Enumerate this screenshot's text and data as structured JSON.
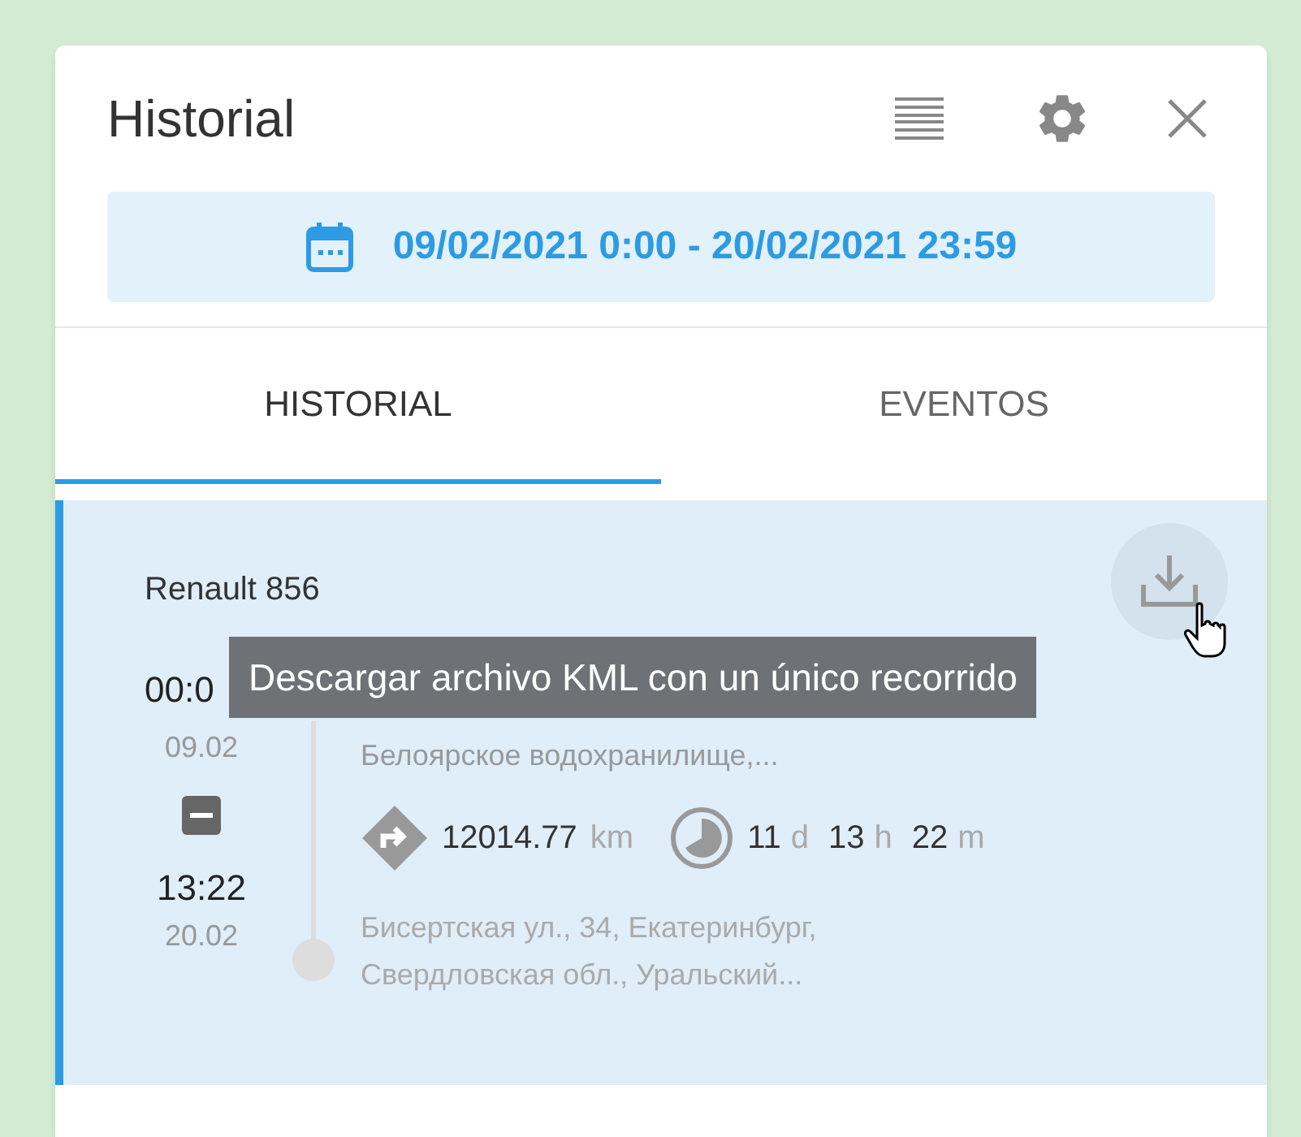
{
  "header": {
    "title": "Historial"
  },
  "date_range": "09/02/2021 0:00 - 20/02/2021 23:59",
  "tabs": [
    {
      "label": "HISTORIAL",
      "selected": true
    },
    {
      "label": "EVENTOS",
      "selected": false
    }
  ],
  "trip": {
    "selected": true,
    "vehicle": "Renault 856",
    "start_time": "00:0",
    "start_date": "09.02",
    "start_address": "Белоярское водохранилище,...",
    "distance": {
      "value": "12014.77",
      "unit": "km"
    },
    "duration": [
      {
        "value": "11",
        "unit": "d"
      },
      {
        "value": "13",
        "unit": "h"
      },
      {
        "value": "22",
        "unit": "m"
      }
    ],
    "end_time": "13:22",
    "end_date": "20.02",
    "end_address": "Бисертская ул., 34, Екатеринбург, Свердловская обл., Уральский..."
  },
  "tooltip": "Descargar archivo KML con un único recorrido"
}
